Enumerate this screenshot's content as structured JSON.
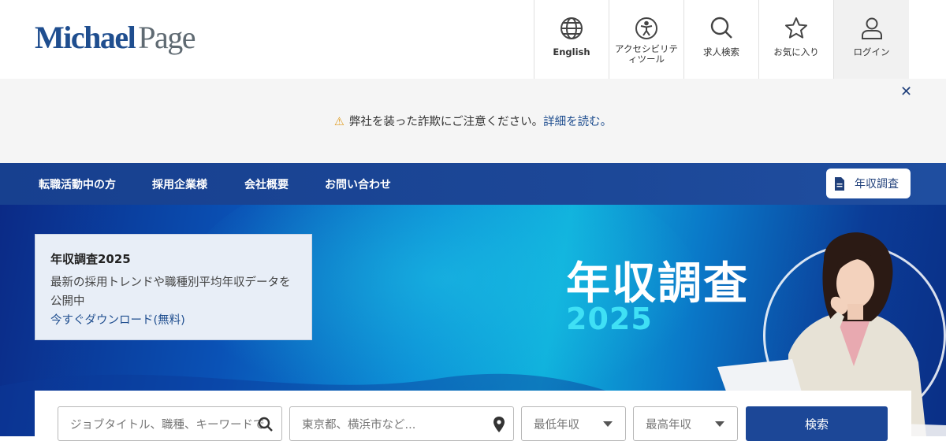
{
  "brand": {
    "part1": "Michael",
    "part2": "Page"
  },
  "header_nav": [
    {
      "name": "language",
      "label": "English",
      "icon": "globe-icon"
    },
    {
      "name": "accessibility",
      "label": "アクセシビリティツール",
      "icon": "accessibility-icon"
    },
    {
      "name": "job-search",
      "label": "求人検索",
      "icon": "search-icon"
    },
    {
      "name": "favorites",
      "label": "お気に入り",
      "icon": "star-icon"
    },
    {
      "name": "login",
      "label": "ログイン",
      "icon": "user-icon"
    }
  ],
  "alert": {
    "text": "弊社を装った詐欺にご注意ください。",
    "link": "詳細を読む。",
    "close_icon": "close-icon",
    "warning_color": "#e09a1c"
  },
  "main_nav": {
    "items": [
      "転職活動中の方",
      "採用企業様",
      "会社概要",
      "お問い合わせ"
    ],
    "survey_button": "年収調査"
  },
  "hero": {
    "title": "年収調査",
    "year": "2025"
  },
  "info_card": {
    "title": "年収調査2025",
    "description": "最新の採用トレンドや職種別平均年収データを公開中",
    "link": "今すぐダウンロード(無料)"
  },
  "search": {
    "keyword_placeholder": "ジョブタイトル、職種、キーワードで",
    "location_placeholder": "東京都、横浜市など...",
    "min_salary": "最低年収",
    "max_salary": "最高年収",
    "button": "検索"
  },
  "colors": {
    "brand_blue": "#1f4e8f",
    "nav_blue": "#17408f",
    "accent_cyan": "#3fe0f5"
  }
}
